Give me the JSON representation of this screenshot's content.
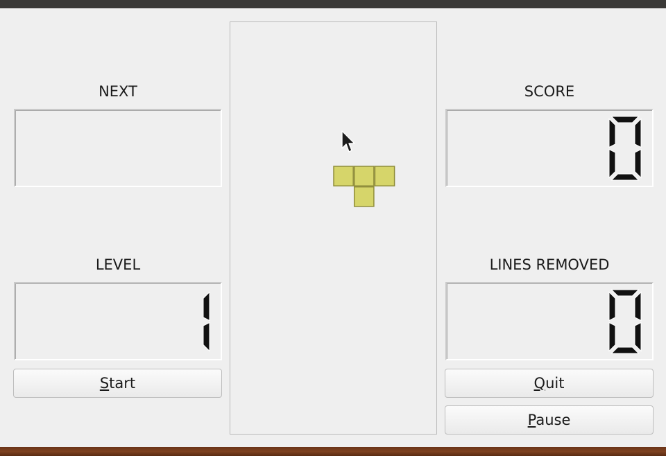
{
  "labels": {
    "next": "NEXT",
    "level": "LEVEL",
    "score": "SCORE",
    "lines_removed": "LINES REMOVED"
  },
  "values": {
    "level": "1",
    "score": "0",
    "lines_removed": "0"
  },
  "buttons": {
    "start": {
      "mnemonic": "S",
      "rest": "tart"
    },
    "quit": {
      "mnemonic": "Q",
      "rest": "uit"
    },
    "pause": {
      "mnemonic": "P",
      "rest": "ause"
    }
  },
  "piece": {
    "type": "T",
    "color": "#d6d56a",
    "border_color": "#8f8d3a",
    "cells": [
      [
        0,
        0
      ],
      [
        1,
        0
      ],
      [
        2,
        0
      ],
      [
        1,
        1
      ]
    ]
  },
  "colors": {
    "window_bg": "#efefef",
    "titlebar": "#3a3937",
    "desktop": "#7e4220",
    "lcd_segment": "#111111"
  },
  "icons": {
    "cursor": "arrow-cursor-icon"
  }
}
